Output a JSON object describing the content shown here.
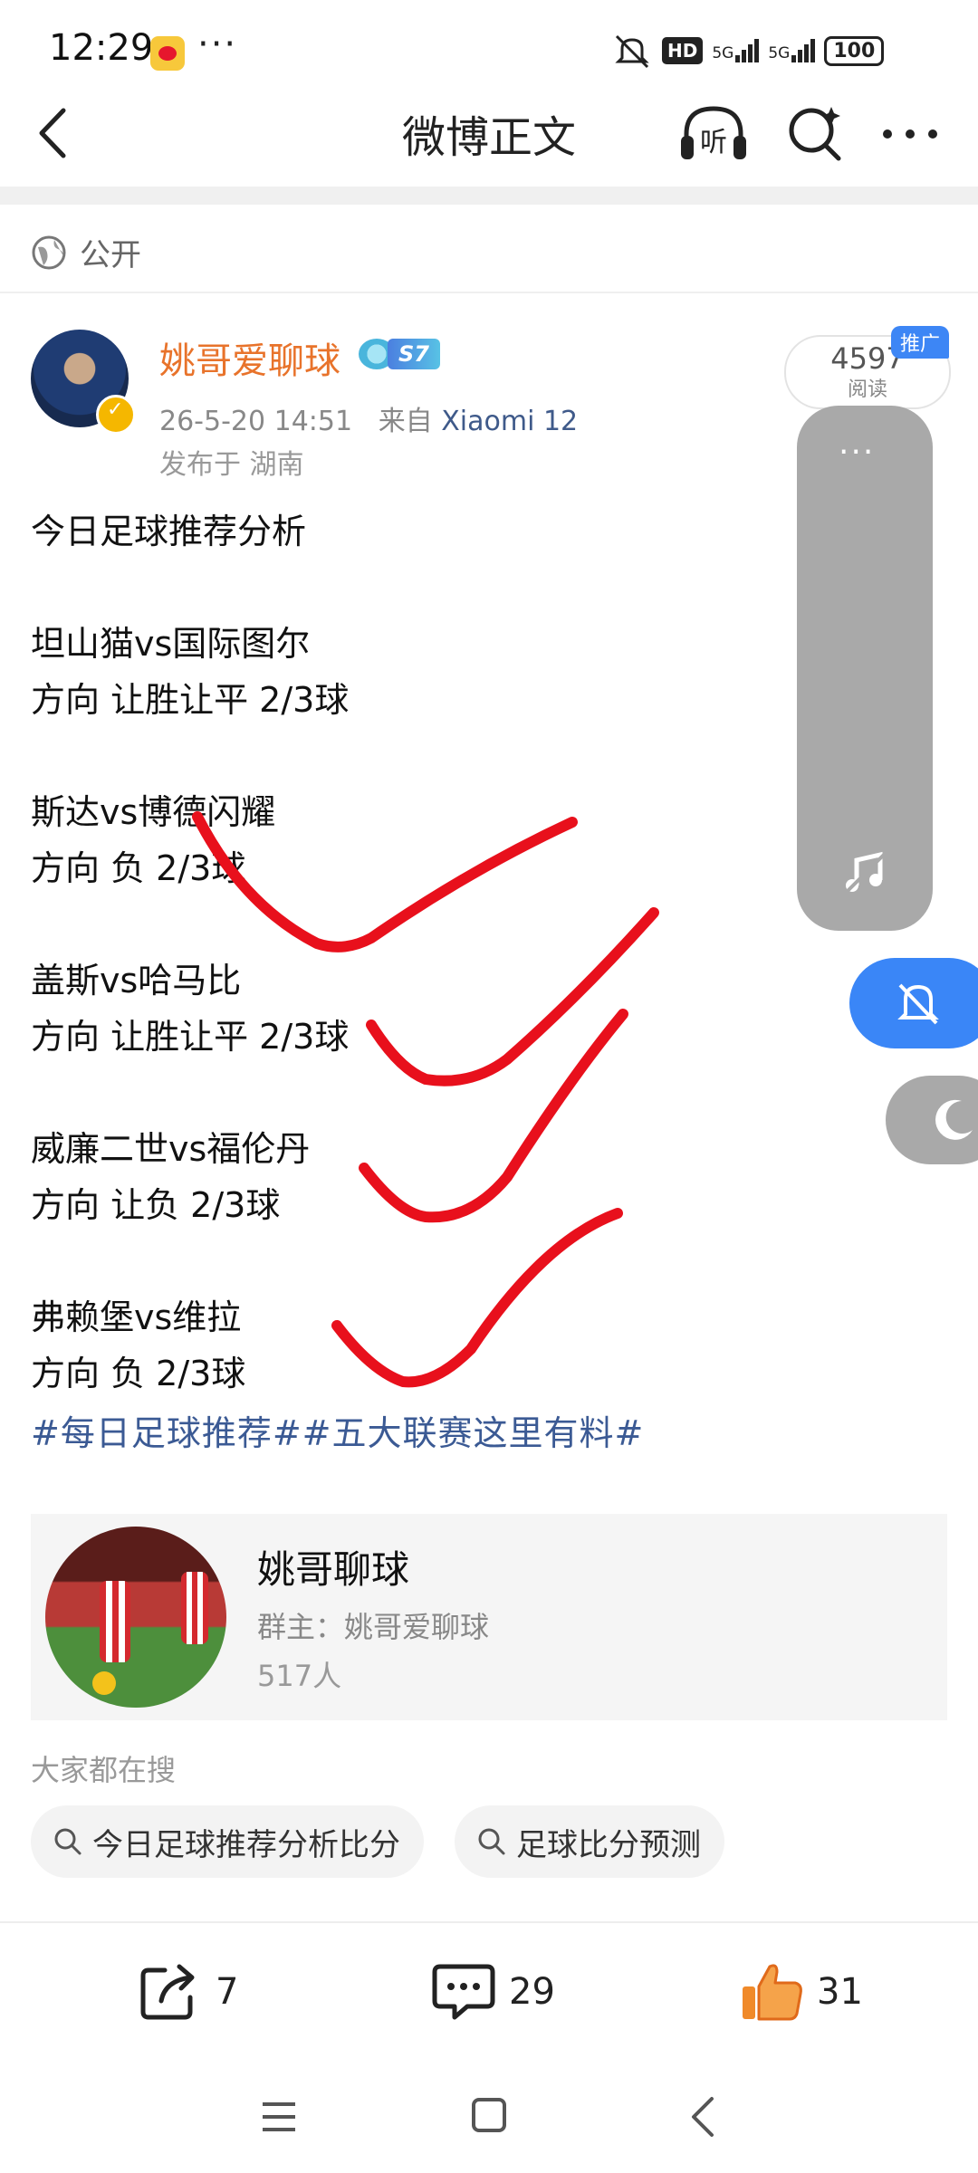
{
  "status_bar": {
    "time": "12:29",
    "left_icons": [
      "weibo-app-icon",
      "more-dots"
    ],
    "more_dots": "···",
    "hd_label": "HD",
    "network_1": "5G",
    "network_2": "5G",
    "battery": "100"
  },
  "nav": {
    "title": "微博正文",
    "listen_label": "听",
    "icons": [
      "back-icon",
      "listen-icon",
      "search-icon",
      "more-icon"
    ]
  },
  "visibility": {
    "label": "公开"
  },
  "post": {
    "author": "姚哥爱聊球",
    "level": "S7",
    "time": "26-5-20 14:51",
    "source_prefix": "来自",
    "source_device": "Xiaomi 12",
    "location": "发布于 湖南",
    "read_count": "4597",
    "read_label": "阅读",
    "promo_tag": "推广",
    "lines": [
      "今日足球推荐分析",
      "坦山猫vs国际图尔",
      "方向 让胜让平 2/3球",
      "斯达vs博德闪耀",
      "方向 负 2/3球",
      "盖斯vs哈马比",
      "方向 让胜让平 2/3球",
      "威廉二世vs福伦丹",
      "方向 让负 2/3球",
      "弗赖堡vs维拉",
      "方向 负 2/3球"
    ],
    "hashtags": "#每日足球推荐##五大联赛这里有料#"
  },
  "floating": {
    "panel_dots": "···",
    "colors": {
      "bell": "#3a86f7",
      "panel": "#a9a9a9"
    }
  },
  "group": {
    "name": "姚哥聊球",
    "owner": "群主：姚哥爱聊球",
    "members": "517人"
  },
  "search": {
    "heading": "大家都在搜",
    "chips": [
      "今日足球推荐分析比分",
      "足球比分预测"
    ]
  },
  "actions": {
    "repost": "7",
    "comment": "29",
    "like": "31"
  },
  "colors": {
    "author": "#e8732b",
    "hashtag": "#3b5a94",
    "check_marks": "#e8101c"
  }
}
